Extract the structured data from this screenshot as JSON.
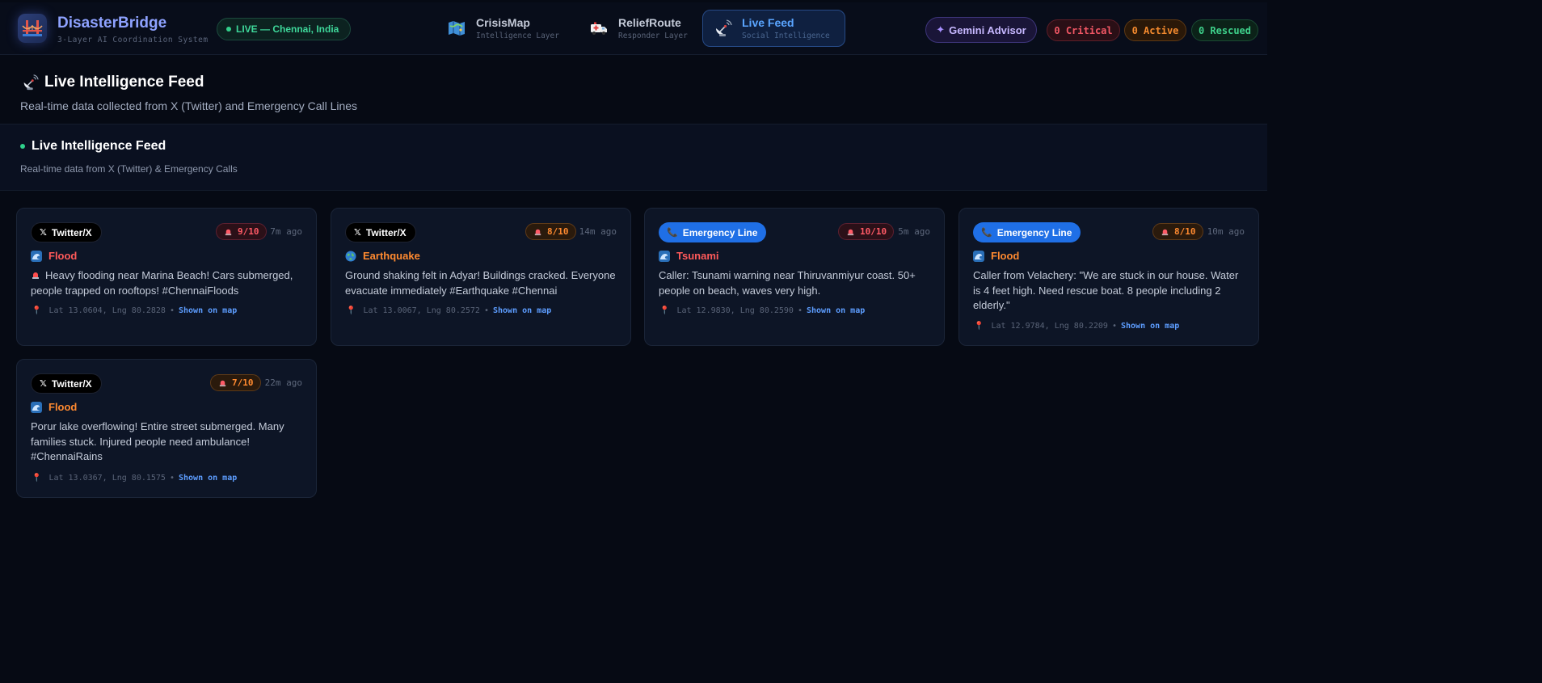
{
  "app": {
    "name": "DisasterBridge",
    "subtitle": "3-Layer AI Coordination System",
    "live_status": "LIVE — Chennai, India"
  },
  "nav": {
    "tabs": [
      {
        "title": "CrisisMap",
        "subtitle": "Intelligence Layer",
        "icon": "map-icon",
        "active": false
      },
      {
        "title": "ReliefRoute",
        "subtitle": "Responder Layer",
        "icon": "ambulance-icon",
        "active": false
      },
      {
        "title": "Live Feed",
        "subtitle": "Social Intelligence",
        "icon": "satellite-dish-icon",
        "active": true
      }
    ]
  },
  "toolbar": {
    "advisor_label": "Gemini Advisor",
    "stats": {
      "critical": "0 Critical",
      "active": "0 Active",
      "rescued": "0 Rescued"
    }
  },
  "page": {
    "title": "Live Intelligence Feed",
    "subtitle": "Real-time data collected from X (Twitter) and Emergency Call Lines"
  },
  "section": {
    "title": "Live Intelligence Feed",
    "subtitle": "Real-time data from X (Twitter) & Emergency Calls"
  },
  "feed": [
    {
      "source": "Twitter/X",
      "source_type": "twitter",
      "severity": "9/10",
      "severity_level": "red",
      "age": "7m ago",
      "type": "Flood",
      "type_color": "red",
      "type_icon": "wave-icon",
      "leading_icon": "siren-icon",
      "message": "Heavy flooding near Marina Beach! Cars submerged, people trapped on rooftops! #ChennaiFloods",
      "coords": "Lat 13.0604, Lng 80.2828",
      "map_link": "Shown on map"
    },
    {
      "source": "Twitter/X",
      "source_type": "twitter",
      "severity": "8/10",
      "severity_level": "orange",
      "age": "14m ago",
      "type": "Earthquake",
      "type_color": "orange",
      "type_icon": "globe-icon",
      "message": "Ground shaking felt in Adyar! Buildings cracked. Everyone evacuate immediately #Earthquake #Chennai",
      "coords": "Lat 13.0067, Lng 80.2572",
      "map_link": "Shown on map"
    },
    {
      "source": "Emergency Line",
      "source_type": "emergency",
      "severity": "10/10",
      "severity_level": "red",
      "age": "5m ago",
      "type": "Tsunami",
      "type_color": "red",
      "type_icon": "wave-icon",
      "message": "Caller: Tsunami warning near Thiruvanmiyur coast. 50+ people on beach, waves very high.",
      "coords": "Lat 12.9830, Lng 80.2590",
      "map_link": "Shown on map"
    },
    {
      "source": "Emergency Line",
      "source_type": "emergency",
      "severity": "8/10",
      "severity_level": "orange",
      "age": "10m ago",
      "type": "Flood",
      "type_color": "orange",
      "type_icon": "wave-icon",
      "message": "Caller from Velachery: \"We are stuck in our house. Water is 4 feet high. Need rescue boat. 8 people including 2 elderly.\"",
      "coords": "Lat 12.9784, Lng 80.2209",
      "map_link": "Shown on map"
    },
    {
      "source": "Twitter/X",
      "source_type": "twitter",
      "severity": "7/10",
      "severity_level": "orange",
      "age": "22m ago",
      "type": "Flood",
      "type_color": "orange",
      "type_icon": "wave-icon",
      "message": "Porur lake overflowing! Entire street submerged. Many families stuck. Injured people need ambulance! #ChennaiRains",
      "coords": "Lat 13.0367, Lng 80.1575",
      "map_link": "Shown on map"
    }
  ]
}
